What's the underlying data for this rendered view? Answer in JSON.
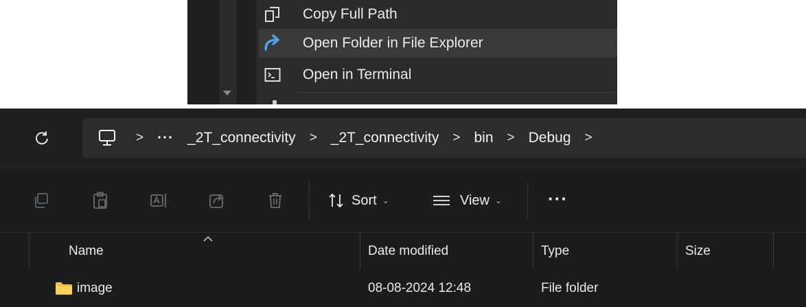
{
  "context_menu": {
    "items": [
      {
        "label": "Copy Full Path",
        "icon": "copy-path-icon"
      },
      {
        "label": "Open Folder in File Explorer",
        "icon": "open-folder-arrow-icon"
      },
      {
        "label": "Open in Terminal",
        "icon": "terminal-icon"
      }
    ]
  },
  "explorer": {
    "address_bar": {
      "root_icon": "this-pc-icon",
      "overflow": "···",
      "crumbs": [
        "_2T_connectivity",
        "_2T_connectivity",
        "bin",
        "Debug"
      ]
    },
    "toolbar": {
      "sort_label": "Sort",
      "view_label": "View",
      "more_label": "···"
    },
    "columns": [
      "Name",
      "Date modified",
      "Type",
      "Size"
    ],
    "rows": [
      {
        "name": "image",
        "date_modified": "08-08-2024 12:48",
        "type": "File folder",
        "size": ""
      }
    ],
    "colors": {
      "folder": "#f0c043",
      "accent": "#4aa3f0"
    }
  }
}
